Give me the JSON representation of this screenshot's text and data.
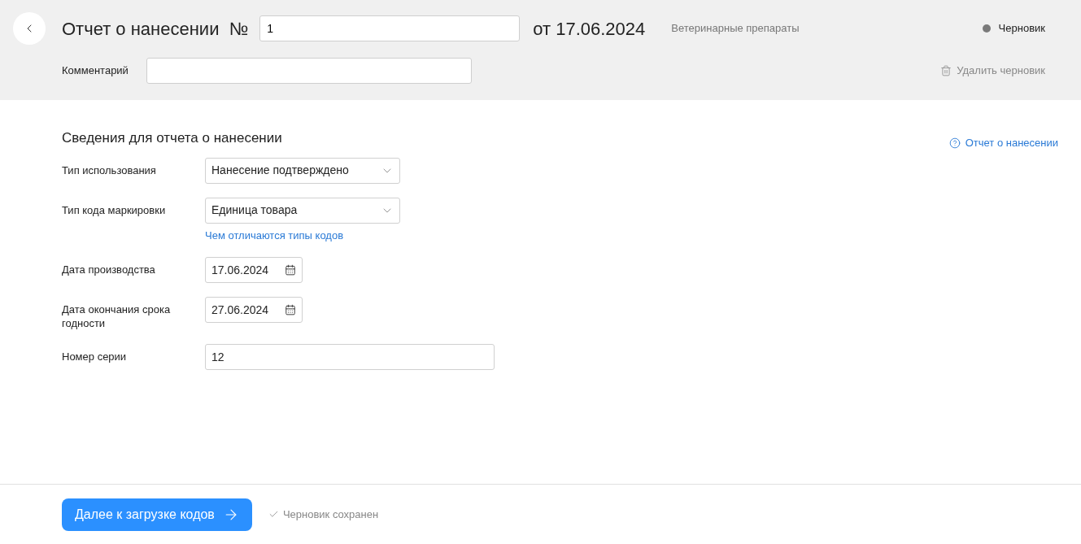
{
  "header": {
    "title": "Отчет о нанесении  №",
    "number": "1",
    "date": "от 17.06.2024",
    "category": "Ветеринарные препараты",
    "status": {
      "label": "Черновик",
      "color": "#7a7a7a"
    },
    "comment_label": "Комментарий",
    "delete_label": "Удалить черновик"
  },
  "section": {
    "title": "Сведения для отчета о нанесении",
    "help_link": "Отчет о нанесении",
    "fields": [
      {
        "kind": "select",
        "label": "Тип использования",
        "value": "Нанесение подтверждено"
      },
      {
        "kind": "select",
        "label": "Тип кода маркировки",
        "value": "Единица товара",
        "link": "Чем отличаются типы кодов"
      },
      {
        "kind": "date",
        "label": "Дата производства",
        "value": "17.06.2024"
      },
      {
        "kind": "date",
        "label": "Дата окончания срока годности",
        "value": "27.06.2024"
      },
      {
        "kind": "text",
        "label": "Номер серии",
        "value": "12"
      }
    ]
  },
  "footer": {
    "next_button": "Далее к загрузке кодов",
    "saved": "Черновик сохранен"
  }
}
